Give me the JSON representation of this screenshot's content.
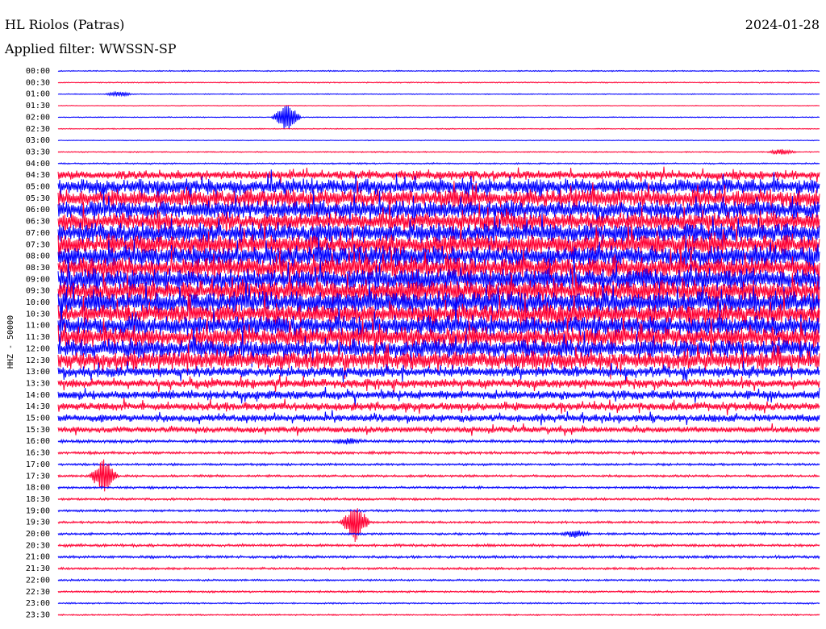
{
  "header": {
    "station": "HL Riolos (Patras)",
    "date": "2024-01-28",
    "filter": "Applied filter: WWSSN-SP"
  },
  "colors": {
    "blue": "#0000ff",
    "red": "#ff0033",
    "background": "#ffffff",
    "text": "#000000"
  },
  "chart_data": {
    "type": "line",
    "subtype": "helicorder",
    "ylabel": "HHZ - 50000",
    "xlabel": "",
    "grid": false,
    "row_interval_minutes": 30,
    "row_colors_alternate": [
      "#0000ff",
      "#ff0033"
    ],
    "ticks": [
      "00:00",
      "00:30",
      "01:00",
      "01:30",
      "02:00",
      "02:30",
      "03:00",
      "03:30",
      "04:00",
      "04:30",
      "05:00",
      "05:30",
      "06:00",
      "06:30",
      "07:00",
      "07:30",
      "08:00",
      "08:30",
      "09:00",
      "09:30",
      "10:00",
      "10:30",
      "11:00",
      "11:30",
      "12:00",
      "12:30",
      "13:00",
      "13:30",
      "14:00",
      "14:30",
      "15:00",
      "15:30",
      "16:00",
      "16:30",
      "17:00",
      "17:30",
      "18:00",
      "18:30",
      "19:00",
      "19:30",
      "20:00",
      "20:30",
      "21:00",
      "21:30",
      "22:00",
      "22:30",
      "23:00",
      "23:30"
    ],
    "relative_noise_amplitude": [
      0.15,
      0.15,
      0.12,
      0.1,
      0.12,
      0.12,
      0.1,
      0.15,
      0.2,
      1.2,
      2.0,
      2.4,
      2.4,
      2.4,
      2.6,
      2.6,
      2.8,
      2.8,
      2.8,
      2.8,
      2.8,
      2.6,
      2.6,
      2.6,
      2.4,
      2.4,
      1.4,
      1.2,
      1.2,
      1.1,
      1.0,
      0.8,
      0.4,
      0.35,
      0.3,
      0.3,
      0.3,
      0.3,
      0.3,
      0.3,
      0.3,
      0.35,
      0.35,
      0.3,
      0.25,
      0.25,
      0.2,
      0.2
    ],
    "annotated_events": [
      {
        "row": "01:00",
        "position": 0.08,
        "amplitude": 0.5
      },
      {
        "row": "02:00",
        "position": 0.3,
        "amplitude": 3.0
      },
      {
        "row": "03:30",
        "position": 0.95,
        "amplitude": 0.6
      },
      {
        "row": "16:00",
        "position": 0.38,
        "amplitude": 0.5
      },
      {
        "row": "17:30",
        "position": 0.06,
        "amplitude": 3.5
      },
      {
        "row": "19:30",
        "position": 0.39,
        "amplitude": 4.0
      },
      {
        "row": "20:00",
        "position": 0.68,
        "amplitude": 0.8
      }
    ]
  }
}
